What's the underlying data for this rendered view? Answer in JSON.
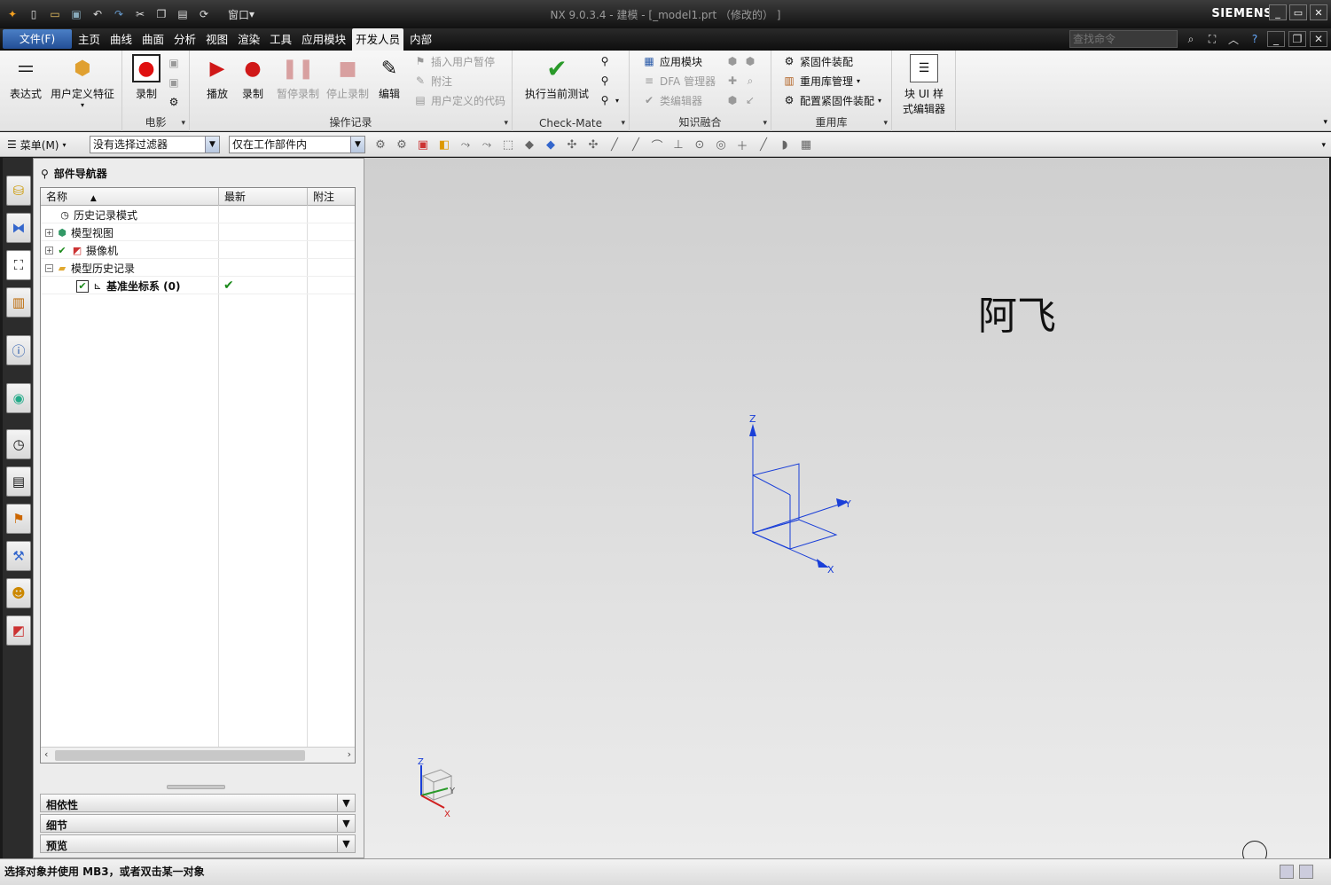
{
  "window": {
    "title": "NX 9.0.3.4 - 建模 - [_model1.prt （修改的） ]",
    "brand": "SIEMENS",
    "quick_access": [
      {
        "icon": "app-logo-icon"
      },
      {
        "icon": "new-file-icon"
      },
      {
        "icon": "open-folder-icon"
      },
      {
        "icon": "save-icon"
      },
      {
        "icon": "undo-icon"
      },
      {
        "icon": "redo-icon"
      },
      {
        "icon": "cut-icon"
      },
      {
        "icon": "copy-icon"
      },
      {
        "icon": "paste-icon"
      },
      {
        "icon": "repeat-command-icon"
      }
    ],
    "window_menu_label": "窗口",
    "controls": [
      "_",
      "▭",
      "✕"
    ]
  },
  "menubar": {
    "file_tab": "文件(F)",
    "tabs": [
      "主页",
      "曲线",
      "曲面",
      "分析",
      "视图",
      "渲染",
      "工具",
      "应用模块",
      "开发人员",
      "内部"
    ],
    "active_tab": "开发人员",
    "search_placeholder": "查找命令"
  },
  "ribbon": {
    "groups": {
      "first": {
        "expression": "表达式",
        "udf": "用户定义特征"
      },
      "movie": {
        "label": "电影",
        "record": "录制"
      },
      "journal": {
        "label": "操作记录",
        "play": "播放",
        "record": "录制",
        "pause": "暂停录制",
        "stop": "停止录制",
        "edit": "编辑",
        "insert_pause": "插入用户暂停",
        "comment": "附注",
        "user_code": "用户定义的代码"
      },
      "checkmate": {
        "label": "Check-Mate",
        "run": "执行当前测试"
      },
      "knowledge": {
        "label": "知识融合",
        "app_module": "应用模块",
        "dfa": "DFA 管理器",
        "class_editor": "类编辑器"
      },
      "reuse": {
        "label": "重用库",
        "fastener": "紧固件装配",
        "reuse_mgr": "重用库管理",
        "config_fastener": "配置紧固件装配"
      },
      "blockui": {
        "label_line1": "块 UI 样",
        "label_line2": "式编辑器"
      }
    }
  },
  "toolbar": {
    "menu_label": "菜单(M)",
    "filter_value": "没有选择过滤器",
    "scope_value": "仅在工作部件内"
  },
  "navigator": {
    "title": "部件导航器",
    "columns": [
      "名称",
      "最新",
      "附注"
    ],
    "rows": [
      {
        "name": "历史记录模式",
        "latest": ""
      },
      {
        "name": "模型视图",
        "latest": ""
      },
      {
        "name": "摄像机",
        "latest": ""
      },
      {
        "name": "模型历史记录",
        "latest": ""
      },
      {
        "name": "基准坐标系 (0)",
        "latest": "✔"
      }
    ],
    "panels": [
      "相依性",
      "细节",
      "预览"
    ]
  },
  "graphics": {
    "overlay_text": "阿飞",
    "axis_labels": {
      "z": "Z",
      "y": "Y",
      "x": "X"
    }
  },
  "statusbar": {
    "message": "选择对象并使用 MB3，或者双击某一对象"
  },
  "colors": {
    "accent": "#2a5aa8",
    "axis_blue": "#1a3fd8",
    "check_green": "#1a8a1a"
  }
}
